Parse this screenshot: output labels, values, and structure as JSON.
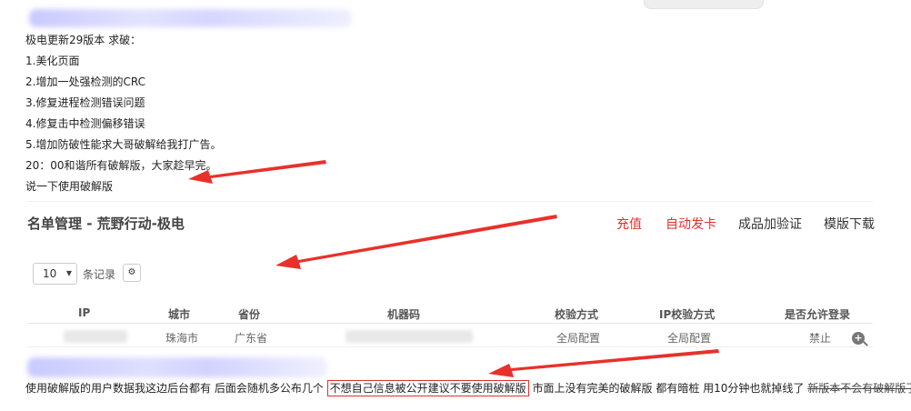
{
  "post": {
    "lines": [
      "极电更新29版本 求破：",
      "1.美化页面",
      "2.增加一处强检测的CRC",
      "3.修复进程检测错误问题",
      "4.修复击中检测偏移错误",
      "5.增加防破性能求大哥破解给我打广告。",
      "20：00和谐所有破解版，大家趁早完。",
      "说一下使用破解版"
    ]
  },
  "screenshot": {
    "title": "名单管理 - 荒野行动-极电",
    "nav": [
      "充值",
      "自动发卡",
      "成品加验证",
      "模版下载"
    ],
    "page_size": "10",
    "records_label": "条记录",
    "columns": [
      "IP",
      "城市",
      "省份",
      "机器码",
      "校验方式",
      "IP校验方式",
      "是否允许登录"
    ],
    "row": {
      "city": "珠海市",
      "province": "广东省",
      "check": "全局配置",
      "ip_check": "全局配置",
      "allow_login": "禁止"
    }
  },
  "bottom": {
    "before": "使用破解版的用户数据我这边后台都有 后面会随机多公布几个",
    "boxed": "不想自己信息被公开建议不要使用破解版",
    "after": "市面上没有完美的破解版 都有暗桩 用10分钟也就掉线了",
    "struck": "新版本不会有破解版了"
  },
  "colors": {
    "accent_red": "#e03030",
    "blur_purple": "#d6d6ff"
  }
}
